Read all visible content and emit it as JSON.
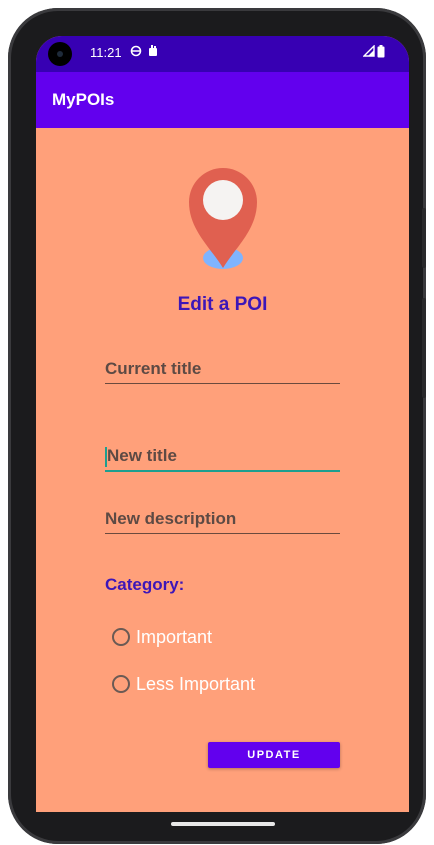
{
  "status_bar": {
    "time": "11:21"
  },
  "app_bar": {
    "title": "MyPOIs"
  },
  "form": {
    "heading": "Edit a POI",
    "current_title_hint": "Current title",
    "new_title_hint": "New title",
    "new_description_hint": "New description",
    "category_label": "Category:",
    "options": [
      {
        "label": "Important",
        "selected": false
      },
      {
        "label": "Less Important",
        "selected": false
      }
    ],
    "update_label": "UPDATE"
  },
  "colors": {
    "status_bar": "#3700b3",
    "app_bar": "#6200ee",
    "background": "#ffa07a",
    "accent_text": "#3d16b8",
    "pin_red": "#e06050",
    "pin_shadow": "#7fb4ff",
    "focus_underline": "#1e9e8f"
  },
  "icons": {
    "pin": "location-pin-icon"
  }
}
